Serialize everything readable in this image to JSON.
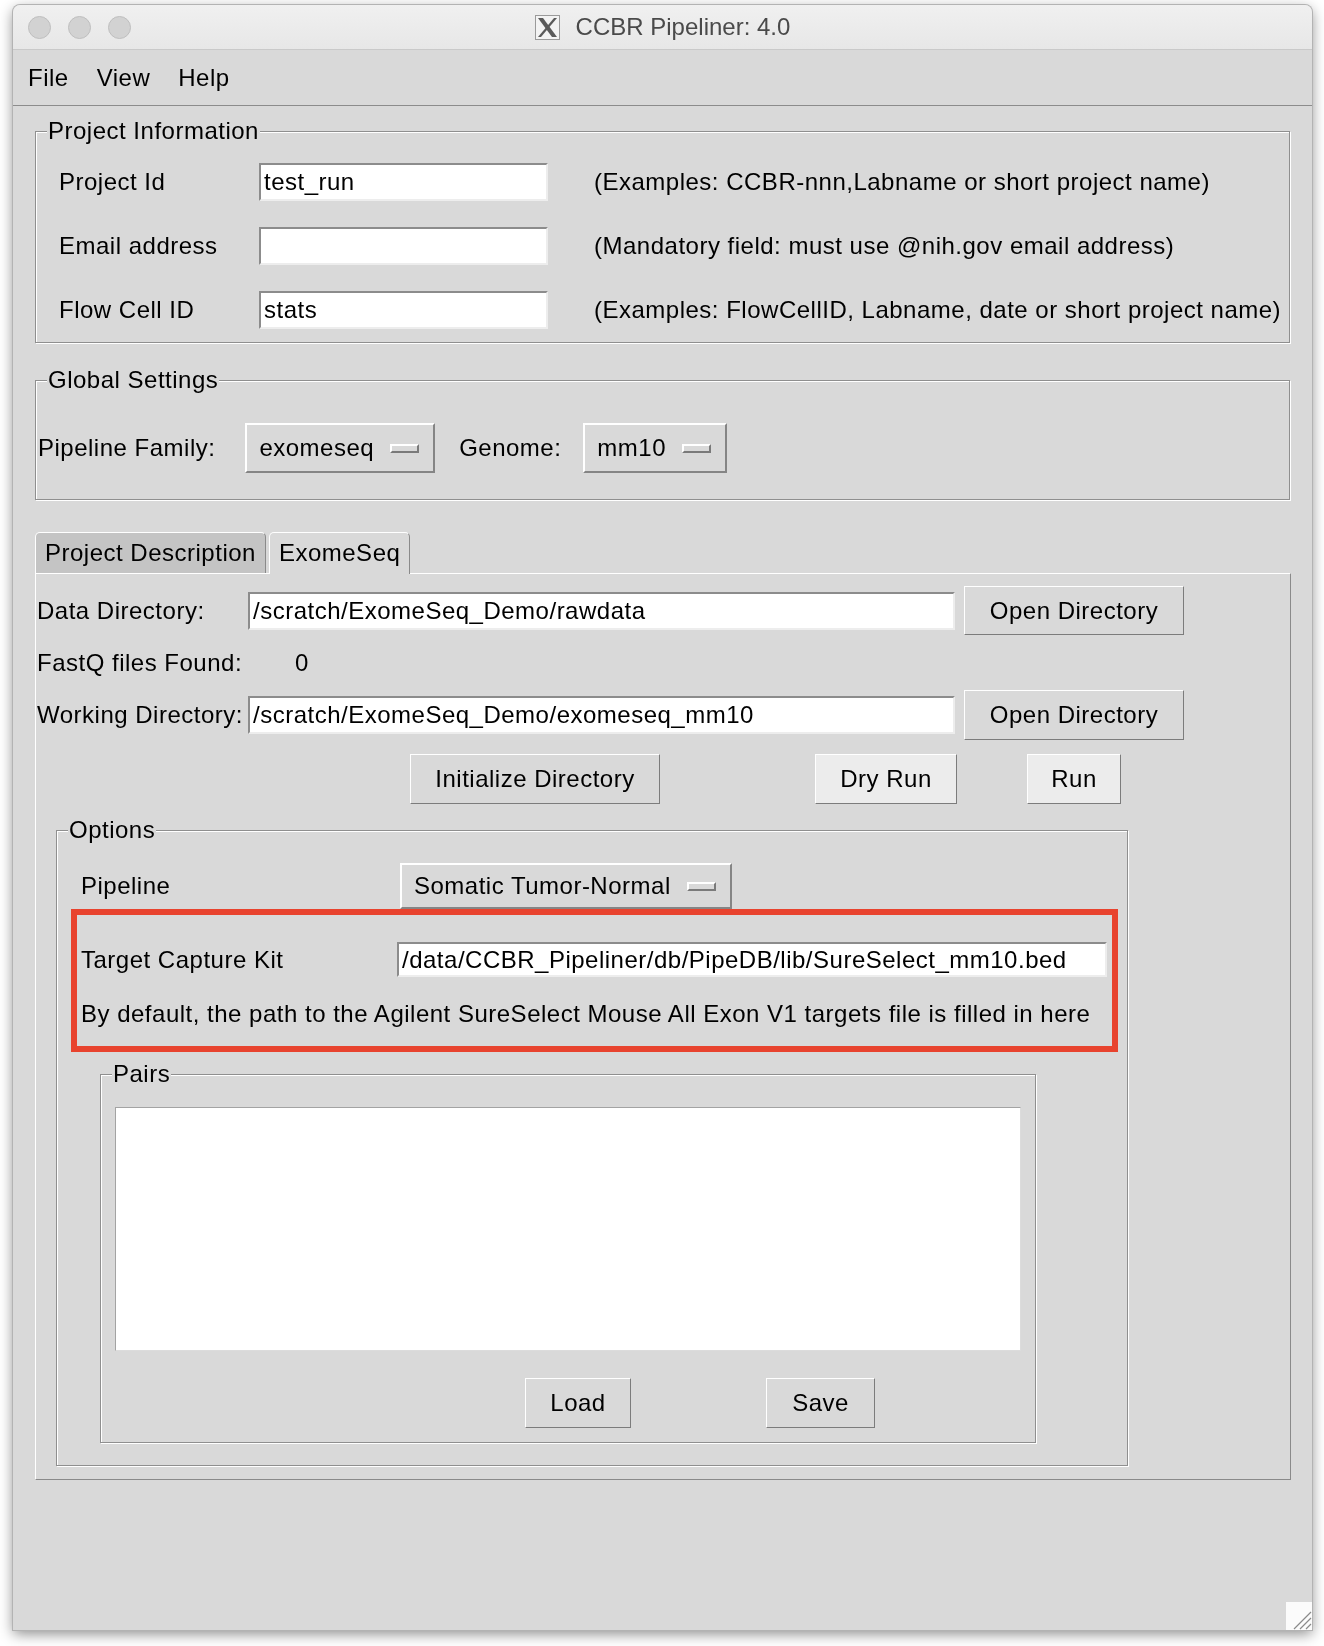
{
  "window": {
    "title": "CCBR Pipeliner: 4.0"
  },
  "menu": [
    "File",
    "View",
    "Help"
  ],
  "project_information": {
    "title": "Project Information",
    "fields": [
      {
        "label": "Project Id",
        "value": "test_run",
        "hint": "(Examples: CCBR-nnn,Labname or short project name)"
      },
      {
        "label": "Email address",
        "hint": "(Mandatory field: must use @nih.gov email address)"
      },
      {
        "label": "Flow Cell ID",
        "value": "stats",
        "hint": "(Examples: FlowCellID, Labname, date or short project name)"
      }
    ]
  },
  "global_settings": {
    "title": "Global Settings",
    "pipeline_family": {
      "label": "Pipeline Family:",
      "value": "exomeseq"
    },
    "genome": {
      "label": "Genome:",
      "value": "mm10"
    }
  },
  "tabs": [
    {
      "label": "Project Description",
      "selected": false
    },
    {
      "label": "ExomeSeq",
      "selected": true
    }
  ],
  "exomeseq": {
    "data_directory": {
      "label": "Data Directory:",
      "value": "/scratch/ExomeSeq_Demo/rawdata",
      "button": "Open Directory"
    },
    "fastq_files": {
      "label": "FastQ files Found:",
      "value": "0"
    },
    "working_directory": {
      "label": "Working Directory:",
      "value": "/scratch/ExomeSeq_Demo/exomeseq_mm10",
      "button": "Open Directory"
    },
    "actions": [
      {
        "label": "Initialize Directory",
        "active": false
      },
      {
        "label": "Dry Run",
        "active": true
      },
      {
        "label": "Run",
        "active": true
      }
    ],
    "options": {
      "title": "Options",
      "pipeline": {
        "label": "Pipeline",
        "value": "Somatic Tumor-Normal"
      },
      "target_capture": {
        "highlighted": true,
        "label": "Target Capture Kit",
        "value": "/data/CCBR_Pipeliner/db/PipeDB/lib/SureSelect_mm10.bed",
        "note": "By default, the path to the Agilent SureSelect Mouse All Exon V1 targets file is filled in here"
      },
      "pairs": {
        "title": "Pairs",
        "buttons": [
          "Load",
          "Save"
        ]
      }
    }
  }
}
